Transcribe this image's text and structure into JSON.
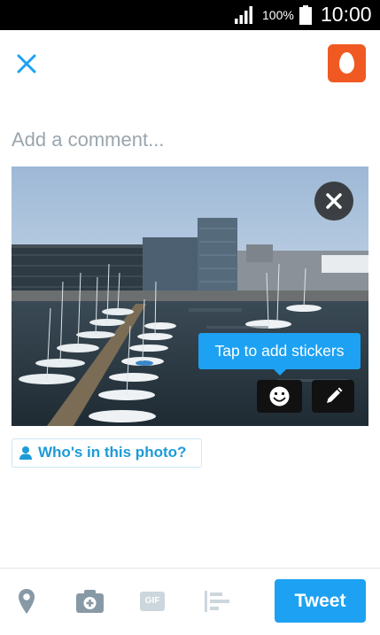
{
  "status_bar": {
    "battery_percent": "100%",
    "time": "10:00"
  },
  "header": {
    "close_icon": "close-icon",
    "avatar_icon": "egg-avatar"
  },
  "composer": {
    "placeholder": "Add a comment..."
  },
  "photo": {
    "description_icon": "harbor-photo",
    "remove_icon": "close-icon",
    "tooltip_text": "Tap to add stickers",
    "sticker_icon": "smiley-icon",
    "edit_icon": "pencil-icon"
  },
  "tag": {
    "label": "Who's in this photo?"
  },
  "toolbar": {
    "location_icon": "location-pin-icon",
    "camera_icon": "camera-icon",
    "gif_label": "GIF",
    "poll_icon": "poll-icon",
    "tweet_label": "Tweet"
  },
  "colors": {
    "accent": "#1da1f2",
    "avatar_bg": "#f05a22",
    "statusbar": "#000000"
  }
}
